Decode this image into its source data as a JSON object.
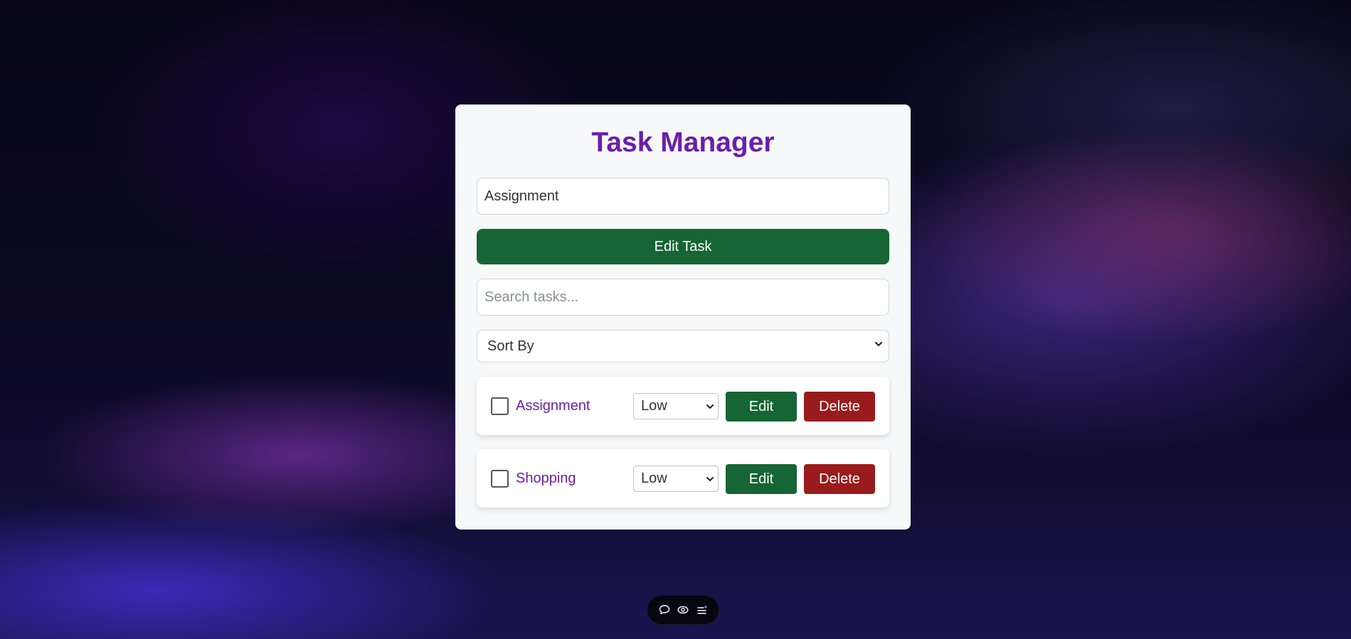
{
  "app": {
    "title": "Task Manager",
    "accent": "#6a1fa8",
    "primary_button_color": "#166534",
    "danger_button_color": "#991b1b"
  },
  "task_input": {
    "value": "Assignment"
  },
  "primary_action": {
    "label": "Edit Task"
  },
  "search": {
    "placeholder": "Search tasks..."
  },
  "sort": {
    "selected": "Sort By"
  },
  "tasks": [
    {
      "name": "Assignment",
      "checked": false,
      "priority": "Low",
      "edit_label": "Edit",
      "delete_label": "Delete"
    },
    {
      "name": "Shopping",
      "checked": false,
      "priority": "Low",
      "edit_label": "Edit",
      "delete_label": "Delete"
    }
  ],
  "dock": {
    "icons": [
      "chat-bubble-icon",
      "eye-icon",
      "list-sparkle-icon"
    ]
  }
}
